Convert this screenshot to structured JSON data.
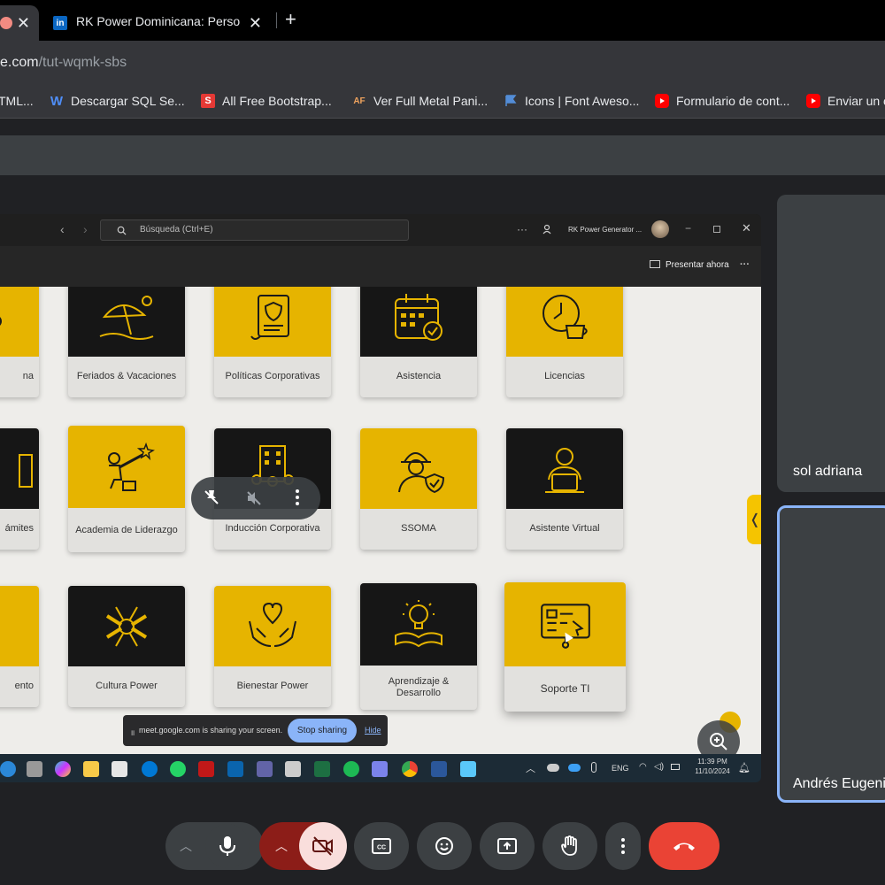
{
  "browser": {
    "tabs": [
      {
        "label": ""
      },
      {
        "label": "RK Power Dominicana: Persor"
      }
    ],
    "new_tab": "+",
    "address": {
      "domain": "e.com",
      "path": "/tut-wqmk-sbs"
    },
    "bookmarks": [
      {
        "label": "TML..."
      },
      {
        "label": "Descargar SQL Se...",
        "icon": "W"
      },
      {
        "label": "All Free Bootstrap...",
        "icon": "S"
      },
      {
        "label": "Ver Full Metal Pani...",
        "icon": "AF"
      },
      {
        "label": "Icons | Font Aweso..."
      },
      {
        "label": "Formulario de cont..."
      },
      {
        "label": "Enviar un c"
      }
    ]
  },
  "shared_screen": {
    "teams": {
      "search_placeholder": "Búsqueda (Ctrl+E)",
      "account": "RK Power Generator ...",
      "more": "···",
      "present_now": "Presentar ahora"
    },
    "cards": [
      {
        "label": "na",
        "color": "yellow"
      },
      {
        "label": "Feriados & Vacaciones",
        "color": "black"
      },
      {
        "label": "Políticas Corporativas",
        "color": "yellow"
      },
      {
        "label": "Asistencia",
        "color": "black"
      },
      {
        "label": "Licencias",
        "color": "yellow"
      },
      {
        "label": "ámites",
        "color": "black"
      },
      {
        "label": "Academia de Liderazgo",
        "color": "yellow"
      },
      {
        "label": "Inducción Corporativa",
        "color": "black"
      },
      {
        "label": "SSOMA",
        "color": "yellow"
      },
      {
        "label": "Asistente Virtual",
        "color": "black"
      },
      {
        "label": "ento",
        "color": "yellow"
      },
      {
        "label": "Cultura Power",
        "color": "black"
      },
      {
        "label": "Bienestar Power",
        "color": "yellow"
      },
      {
        "label": "Aprendizaje & Desarrollo",
        "color": "black"
      },
      {
        "label": "Soporte TI",
        "color": "yellow"
      }
    ],
    "sharing_bar": {
      "message": "meet.google.com is sharing your screen.",
      "stop": "Stop sharing",
      "hide": "Hide"
    },
    "taskbar": {
      "language": "ENG",
      "time": "11:39 PM",
      "date": "11/10/2024"
    }
  },
  "participants": [
    {
      "name": "sol adriana"
    },
    {
      "name": "Andrés Eugeni"
    }
  ],
  "colors": {
    "accent_yellow": "#e6b400",
    "end_call_red": "#ea4335",
    "cam_off_pink": "#f9dedc",
    "speaker_border": "#8ab4f8"
  }
}
